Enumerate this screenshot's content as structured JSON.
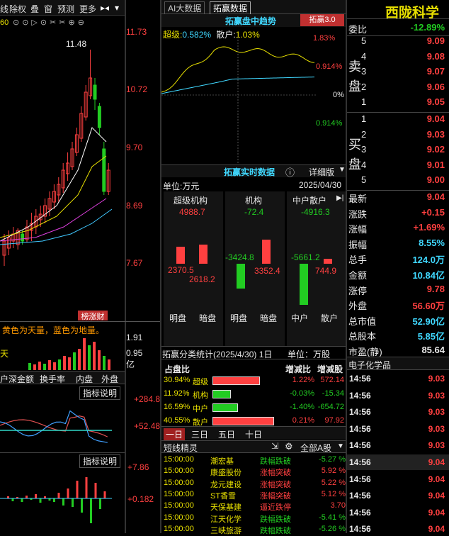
{
  "toolbar": {
    "items": [
      "线",
      "除权",
      "叠",
      "窗",
      "预测",
      "更多"
    ]
  },
  "kline": {
    "prices": [
      "11.73",
      "10.72",
      "9.70",
      "8.69",
      "7.67"
    ],
    "peak": "11.48",
    "label": "榜涨财",
    "vol_ticks": [
      "1.91",
      "0.95",
      "亿"
    ],
    "vol_note": "黄色为天量，蓝色为地量。",
    "vol_tag": "天",
    "tabs": [
      "户深金额",
      "换手率",
      "内盘",
      "外盘"
    ],
    "ind1": {
      "title": "指标说明",
      "v1": "+284.8",
      "v2": "+52.48"
    },
    "ind2": {
      "title": "指标说明",
      "v1": "+7.86",
      "v2": "+0.182"
    },
    "small_num": "60"
  },
  "tabs_top": [
    "AI大数据",
    "拓赢数据"
  ],
  "trend": {
    "title": "拓赢盘中趋势",
    "badge": "拓赢3.0",
    "super_label": "超级:",
    "super_val": "0.582%",
    "retail_label": "散户:",
    "retail_val": "1.03%",
    "y_ticks": [
      "1.83%",
      "0.914%",
      "0%",
      "0.914%"
    ]
  },
  "realtime": {
    "title": "拓赢实时数据",
    "detail": "详细版",
    "unit": "单位:万元",
    "date": "2025/04/30",
    "cols": [
      {
        "name": "超级机构",
        "val": "4988.7",
        "a": "2370.5",
        "b": "2618.2"
      },
      {
        "name": "机构",
        "val": "-72.4",
        "a": "-3424.8",
        "b": "3352.4"
      },
      {
        "name": "中户散户",
        "val": "-4916.3",
        "a": "-5661.2",
        "b": "744.9"
      }
    ],
    "labels": [
      "明盘",
      "暗盘",
      "明盘",
      "暗盘",
      "中户",
      "散户"
    ]
  },
  "classify": {
    "title": "拓赢分类统计(2025/4/30) 1日",
    "unit": "单位：万股",
    "h1": "占盘比",
    "h2": "增减比",
    "h3": "增减股",
    "rows": [
      {
        "pct": "30.94%",
        "name": "超级",
        "chg": "1.22%",
        "qty": "572.14",
        "bar": 0.3094,
        "color": "#ff4040"
      },
      {
        "pct": "11.92%",
        "name": "机构",
        "chg": "-0.03%",
        "qty": "-15.34",
        "bar": 0.1192,
        "color": "#22cc22"
      },
      {
        "pct": "16.59%",
        "name": "中户",
        "chg": "-1.40%",
        "qty": "-654.72",
        "bar": 0.1659,
        "color": "#22cc22"
      },
      {
        "pct": "40.55%",
        "name": "散户",
        "chg": "0.21%",
        "qty": "97.92",
        "bar": 0.4055,
        "color": "#ff4040"
      }
    ]
  },
  "periods": [
    "一日",
    "三日",
    "五日",
    "十日"
  ],
  "sprite": {
    "title": "短线精灵",
    "filter": "全部A股",
    "rows": [
      {
        "t": "15:00:00",
        "n": "潮宏基",
        "e": "跌幅跌破",
        "v": "-5.27 %"
      },
      {
        "t": "15:00:00",
        "n": "康盛股份",
        "e": "涨幅突破",
        "v": "5.92 %"
      },
      {
        "t": "15:00:00",
        "n": "龙元建设",
        "e": "涨幅突破",
        "v": "5.22 %"
      },
      {
        "t": "15:00:00",
        "n": "ST香雪",
        "e": "涨幅突破",
        "v": "5.12 %"
      },
      {
        "t": "15:00:00",
        "n": "天保基建",
        "e": "逼近跌停",
        "v": "3.70"
      },
      {
        "t": "15:00:00",
        "n": "江天化学",
        "e": "跌幅跌破",
        "v": "-5.41 %"
      },
      {
        "t": "15:00:00",
        "n": "三峡旅游",
        "e": "跌幅跌破",
        "v": "-5.26 %"
      }
    ]
  },
  "stock": {
    "name": "西陇科学",
    "webi_label": "委比",
    "webi": "-12.89%",
    "sell": [
      [
        "5",
        "9.09"
      ],
      [
        "4",
        "9.08"
      ],
      [
        "3",
        "9.07"
      ],
      [
        "2",
        "9.06"
      ],
      [
        "1",
        "9.05"
      ]
    ],
    "buy": [
      [
        "1",
        "9.04"
      ],
      [
        "2",
        "9.03"
      ],
      [
        "3",
        "9.02"
      ],
      [
        "4",
        "9.01"
      ],
      [
        "5",
        "9.00"
      ]
    ],
    "sell_label": [
      "卖",
      "盘"
    ],
    "buy_label": [
      "买",
      "盘"
    ],
    "stats": [
      [
        "最新",
        "9.04"
      ],
      [
        "涨跌",
        "+0.15"
      ],
      [
        "涨幅",
        "+1.69%"
      ],
      [
        "振幅",
        "8.55%"
      ],
      [
        "总手",
        "124.0万"
      ],
      [
        "金额",
        "10.84亿"
      ],
      [
        "涨停",
        "9.78"
      ],
      [
        "外盘",
        "56.60万"
      ],
      [
        "总市值",
        "52.90亿"
      ],
      [
        "总股本",
        "5.85亿"
      ],
      [
        "市盈(静)",
        "85.64"
      ]
    ],
    "industry": "电子化学品",
    "ticks": [
      [
        "14:56",
        "9.03"
      ],
      [
        "14:56",
        "9.03"
      ],
      [
        "14:56",
        "9.03"
      ],
      [
        "14:56",
        "9.03"
      ],
      [
        "14:56",
        "9.03"
      ],
      [
        "14:56",
        "9.04"
      ],
      [
        "14:56",
        "9.04"
      ],
      [
        "14:56",
        "9.04"
      ],
      [
        "14:56",
        "9.04"
      ],
      [
        "14:56",
        "9.04"
      ]
    ]
  }
}
